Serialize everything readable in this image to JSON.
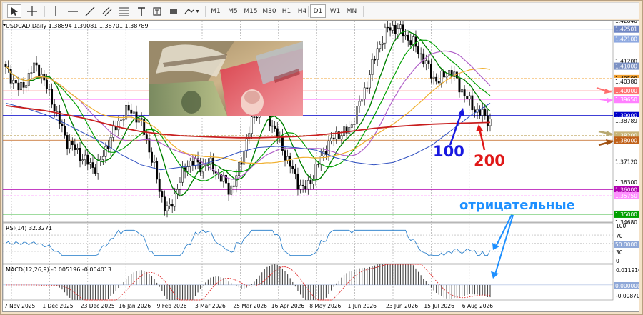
{
  "toolbar": {
    "timeframes": [
      "M1",
      "M5",
      "M15",
      "M30",
      "H1",
      "H4",
      "D1",
      "W1",
      "MN"
    ],
    "active_timeframe": "D1"
  },
  "main": {
    "header": "USDCAD,Daily  1.38894 1.39081 1.38701 1.38789",
    "price_labels": [
      {
        "text": "1.42840",
        "color": "#ffffff",
        "text_color": "#000000"
      },
      {
        "text": "1.42501",
        "color": "#6f86c4",
        "text_color": "#ffffff"
      },
      {
        "text": "1.42100",
        "color": "#8da8e0",
        "text_color": "#ffffff"
      },
      {
        "text": "1.41200",
        "color": "#ffffff",
        "text_color": "#000000"
      },
      {
        "text": "1.41000",
        "color": "#7d92c4",
        "text_color": "#ffffff"
      },
      {
        "text": "1.40500",
        "color": "#f0a030",
        "text_color": "#000000"
      },
      {
        "text": "1.40380",
        "color": "#ffffff",
        "text_color": "#000000"
      },
      {
        "text": "1.40000",
        "color": "#ff6e6e",
        "text_color": "#ffffff"
      },
      {
        "text": "1.39650",
        "color": "#ff80ff",
        "text_color": "#ffffff"
      },
      {
        "text": "1.39000",
        "color": "#0000c8",
        "text_color": "#ffffff"
      },
      {
        "text": "1.38789",
        "color": "#ffffff",
        "text_color": "#000000"
      },
      {
        "text": "1.38200",
        "color": "#c8b478",
        "text_color": "#ffffff"
      },
      {
        "text": "1.38000",
        "color": "#c06018",
        "text_color": "#ffffff"
      },
      {
        "text": "1.37120",
        "color": "#ffffff",
        "text_color": "#000000"
      },
      {
        "text": "1.36300",
        "color": "#ffffff",
        "text_color": "#000000"
      },
      {
        "text": "1.36000",
        "color": "#b000b0",
        "text_color": "#ffffff"
      },
      {
        "text": "1.35750",
        "color": "#ff90ff",
        "text_color": "#ffffff"
      },
      {
        "text": "1.35000",
        "color": "#00a000",
        "text_color": "#ffffff"
      },
      {
        "text": "1.34680",
        "color": "#ffffff",
        "text_color": "#000000"
      }
    ],
    "annotations": {
      "ma100": "100",
      "ma200": "200",
      "negative": "отрицательные"
    }
  },
  "rsi": {
    "header": "RSI(14) 32.3271",
    "levels": [
      "100",
      "70",
      "50.0000",
      "30",
      "0"
    ]
  },
  "macd": {
    "header": "MACD(12,26,9) -0.005196 -0.004013",
    "levels": [
      "0.011916",
      "0.000000",
      "-0.008709"
    ]
  },
  "xaxis": {
    "labels": [
      "7 Nov 2025",
      "1 Dec 2025",
      "23 Dec 2025",
      "16 Jan 2026",
      "9 Feb 2026",
      "3 Mar 2026",
      "25 Mar 2026",
      "16 Apr 2026",
      "8 May 2026",
      "1 Jun 2026",
      "23 Jun 2026",
      "15 Jul 2026",
      "6 Aug 2026"
    ]
  },
  "chart_data": {
    "type": "candlestick",
    "symbol": "USDCAD",
    "timeframe": "Daily",
    "ohlc_last": {
      "open": 1.38894,
      "high": 1.39081,
      "low": 1.38701,
      "close": 1.38789
    },
    "ylim": [
      1.3468,
      1.4284
    ],
    "x_tick_labels": [
      "7 Nov 2025",
      "1 Dec 2025",
      "23 Dec 2025",
      "16 Jan 2026",
      "9 Feb 2026",
      "3 Mar 2026",
      "25 Mar 2026",
      "16 Apr 2026",
      "8 May 2026",
      "1 Jun 2026",
      "23 Jun 2026",
      "15 Jul 2026",
      "6 Aug 2026"
    ],
    "close_path": [
      1.4085,
      1.406,
      1.4035,
      1.4,
      1.403,
      1.406,
      1.41,
      1.409,
      1.405,
      1.4,
      1.396,
      1.39,
      1.385,
      1.38,
      1.378,
      1.376,
      1.374,
      1.372,
      1.37,
      1.369,
      1.37,
      1.374,
      1.379,
      1.383,
      1.386,
      1.39,
      1.392,
      1.3915,
      1.39,
      1.387,
      1.382,
      1.375,
      1.368,
      1.36,
      1.354,
      1.351,
      1.356,
      1.362,
      1.366,
      1.37,
      1.372,
      1.37,
      1.369,
      1.371,
      1.37,
      1.368,
      1.365,
      1.363,
      1.36,
      1.362,
      1.368,
      1.375,
      1.382,
      1.388,
      1.392,
      1.394,
      1.391,
      1.387,
      1.383,
      1.379,
      1.374,
      1.37,
      1.366,
      1.362,
      1.36,
      1.362,
      1.366,
      1.37,
      1.374,
      1.378,
      1.38,
      1.382,
      1.383,
      1.383,
      1.385,
      1.39,
      1.395,
      1.4,
      1.406,
      1.412,
      1.418,
      1.422,
      1.425,
      1.426,
      1.425,
      1.424,
      1.422,
      1.42,
      1.418,
      1.415,
      1.412,
      1.408,
      1.405,
      1.404,
      1.406,
      1.408,
      1.407,
      1.403,
      1.4,
      1.397,
      1.394,
      1.392,
      1.391,
      1.389,
      1.3879
    ],
    "series": [
      {
        "name": "MA 10",
        "color": "#008000"
      },
      {
        "name": "MA 20",
        "color": "#00a000"
      },
      {
        "name": "MA 30",
        "color": "#b060c8"
      },
      {
        "name": "MA 50",
        "color": "#f0b030"
      },
      {
        "name": "MA 100",
        "color": "#3050c0",
        "values": [
          1.395,
          1.393,
          1.3905,
          1.387,
          1.383,
          1.379,
          1.374,
          1.37,
          1.368,
          1.369,
          1.37,
          1.372,
          1.375,
          1.377,
          1.3775,
          1.377,
          1.376,
          1.373,
          1.371,
          1.37,
          1.371,
          1.374,
          1.378,
          1.384,
          1.39,
          1.395
        ]
      },
      {
        "name": "MA 200",
        "color": "#c81e1e",
        "values": [
          1.394,
          1.393,
          1.392,
          1.3905,
          1.389,
          1.387,
          1.385,
          1.3835,
          1.3825,
          1.3818,
          1.3815,
          1.3812,
          1.381,
          1.381,
          1.3812,
          1.3815,
          1.382,
          1.3828,
          1.3838,
          1.3848,
          1.3855,
          1.386,
          1.3865,
          1.3868,
          1.387,
          1.3872
        ]
      }
    ],
    "horizontal_levels": [
      1.42501,
      1.421,
      1.41,
      1.405,
      1.4,
      1.3965,
      1.39,
      1.382,
      1.38,
      1.36,
      1.3575,
      1.35
    ],
    "rsi": {
      "period": 14,
      "last": 32.3271,
      "levels": [
        70,
        50,
        30
      ]
    },
    "macd": {
      "fast": 12,
      "slow": 26,
      "signal": 9,
      "main": -0.005196,
      "signal_value": -0.004013,
      "ylim": [
        -0.008709,
        0.011916
      ]
    }
  }
}
